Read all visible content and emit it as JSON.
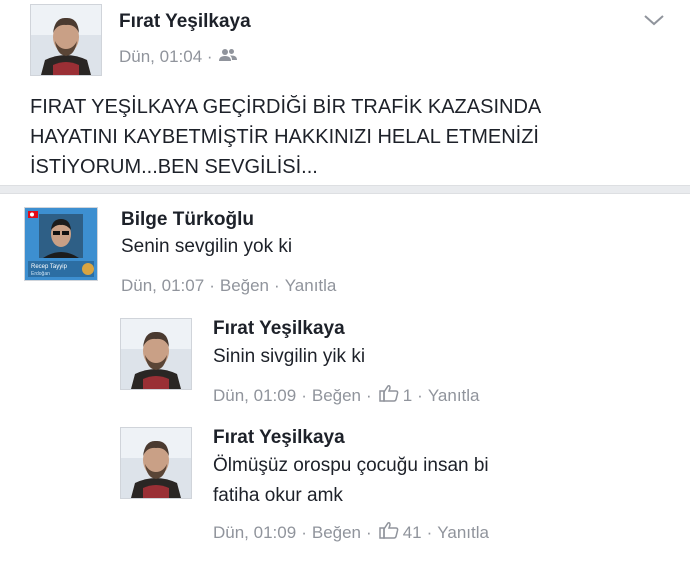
{
  "post": {
    "author": "Fırat Yeşilkaya",
    "time": "Dün, 01:04 ·",
    "audience_icon": "friends-icon",
    "menu_icon": "chevron-down-icon",
    "text": "FIRAT YEŞİLKAYA GEÇİRDİĞİ BİR TRAFİK KAZASINDA\nHAYATINI KAYBETMİŞTİR HAKKINIZI HELAL ETMENİZİ\nİSTİYORUM...BEN SEVGİLİSİ..."
  },
  "comments": [
    {
      "author": "Bilge Türkoğlu",
      "text": "Senin sevgilin yok ki",
      "time": "Dün, 01:07",
      "like_label": "Beğen",
      "reply_label": "Yanıtla",
      "avatar_text": "Recep Tayyip Erdoğan"
    },
    {
      "author": "Fırat Yeşilkaya",
      "text": "Sinin sivgilin yik ki",
      "time": "Dün, 01:09",
      "like_label": "Beğen",
      "like_count": "1",
      "reply_label": "Yanıtla"
    },
    {
      "author": "Fırat Yeşilkaya",
      "text": "Ölmüşüz orospu çocuğu insan bi\nfatiha okur amk",
      "time": "Dün, 01:09",
      "like_label": "Beğen",
      "like_count": "41",
      "reply_label": "Yanıtla"
    }
  ],
  "colors": {
    "text": "#1d2129",
    "meta": "#90949c",
    "separator": "#e9ebee",
    "avatar_blue": "#3d8fd0"
  }
}
